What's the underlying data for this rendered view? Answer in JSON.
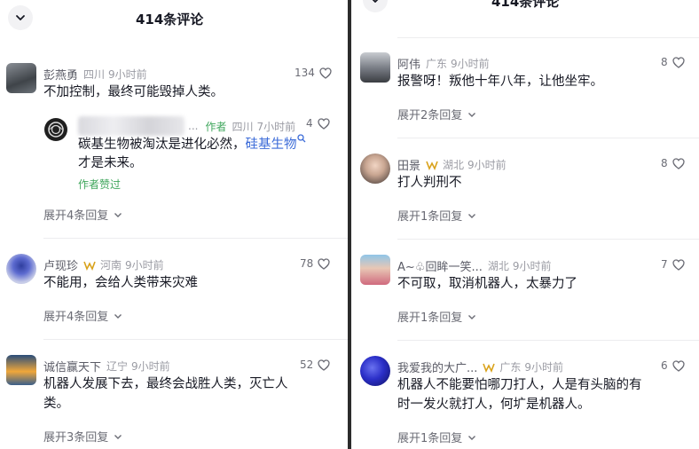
{
  "header": {
    "title": "414条评论"
  },
  "left_comments": [
    {
      "name": "彭燕勇",
      "location": "四川",
      "time": "9小时前",
      "likes": "134",
      "text": "不加控制，最终可能毁掉人类。",
      "expand": "展开4条回复"
    },
    {
      "name": "卢现珍",
      "location": "河南",
      "time": "9小时前",
      "likes": "78",
      "text": "不能用，会给人类带来灾难",
      "expand": "展开4条回复"
    },
    {
      "name": "诚信赢天下",
      "location": "辽宁",
      "time": "9小时前",
      "likes": "52",
      "text_line1": "机器人发展下去，最终会战胜人类，灭亡人",
      "text_line2": "类。",
      "expand": "展开3条回复"
    }
  ],
  "reply": {
    "ellipsis": "...",
    "author_tag": "作者",
    "location": "四川",
    "time": "7小时前",
    "likes": "4",
    "text_part1": "碳基生物被淘汰是进化必然，",
    "text_link": "硅基生物",
    "text_line2": "才是未来。",
    "author_liked": "作者赞过"
  },
  "right_comments": [
    {
      "name": "阿伟",
      "location": "广东",
      "time": "9小时前",
      "likes": "8",
      "text": "报警呀！叛他十年八年，让他坐牢。",
      "expand": "展开2条回复"
    },
    {
      "name": "田景",
      "location": "湖北",
      "time": "9小时前",
      "likes": "8",
      "text": "打人判刑不",
      "expand": "展开1条回复"
    },
    {
      "name": "A~♧回眸一笑...",
      "location": "湖北",
      "time": "9小时前",
      "likes": "7",
      "text": "不可取，取消机器人，太暴力了",
      "expand": "展开1条回复"
    },
    {
      "name": "我爱我的大广...",
      "location": "广东",
      "time": "9小时前",
      "likes": "6",
      "text_line1": "机器人不能要怕哪刀打人，人是有头脑的有",
      "text_line2": "时一发火就打人，何圹是机器人。",
      "expand": "展开1条回复"
    }
  ],
  "colors": {
    "author_green": "#3fa65c",
    "link_blue": "#3b6bd8",
    "badge_gold": "#d9a21b",
    "muted": "#9a9ba3"
  }
}
